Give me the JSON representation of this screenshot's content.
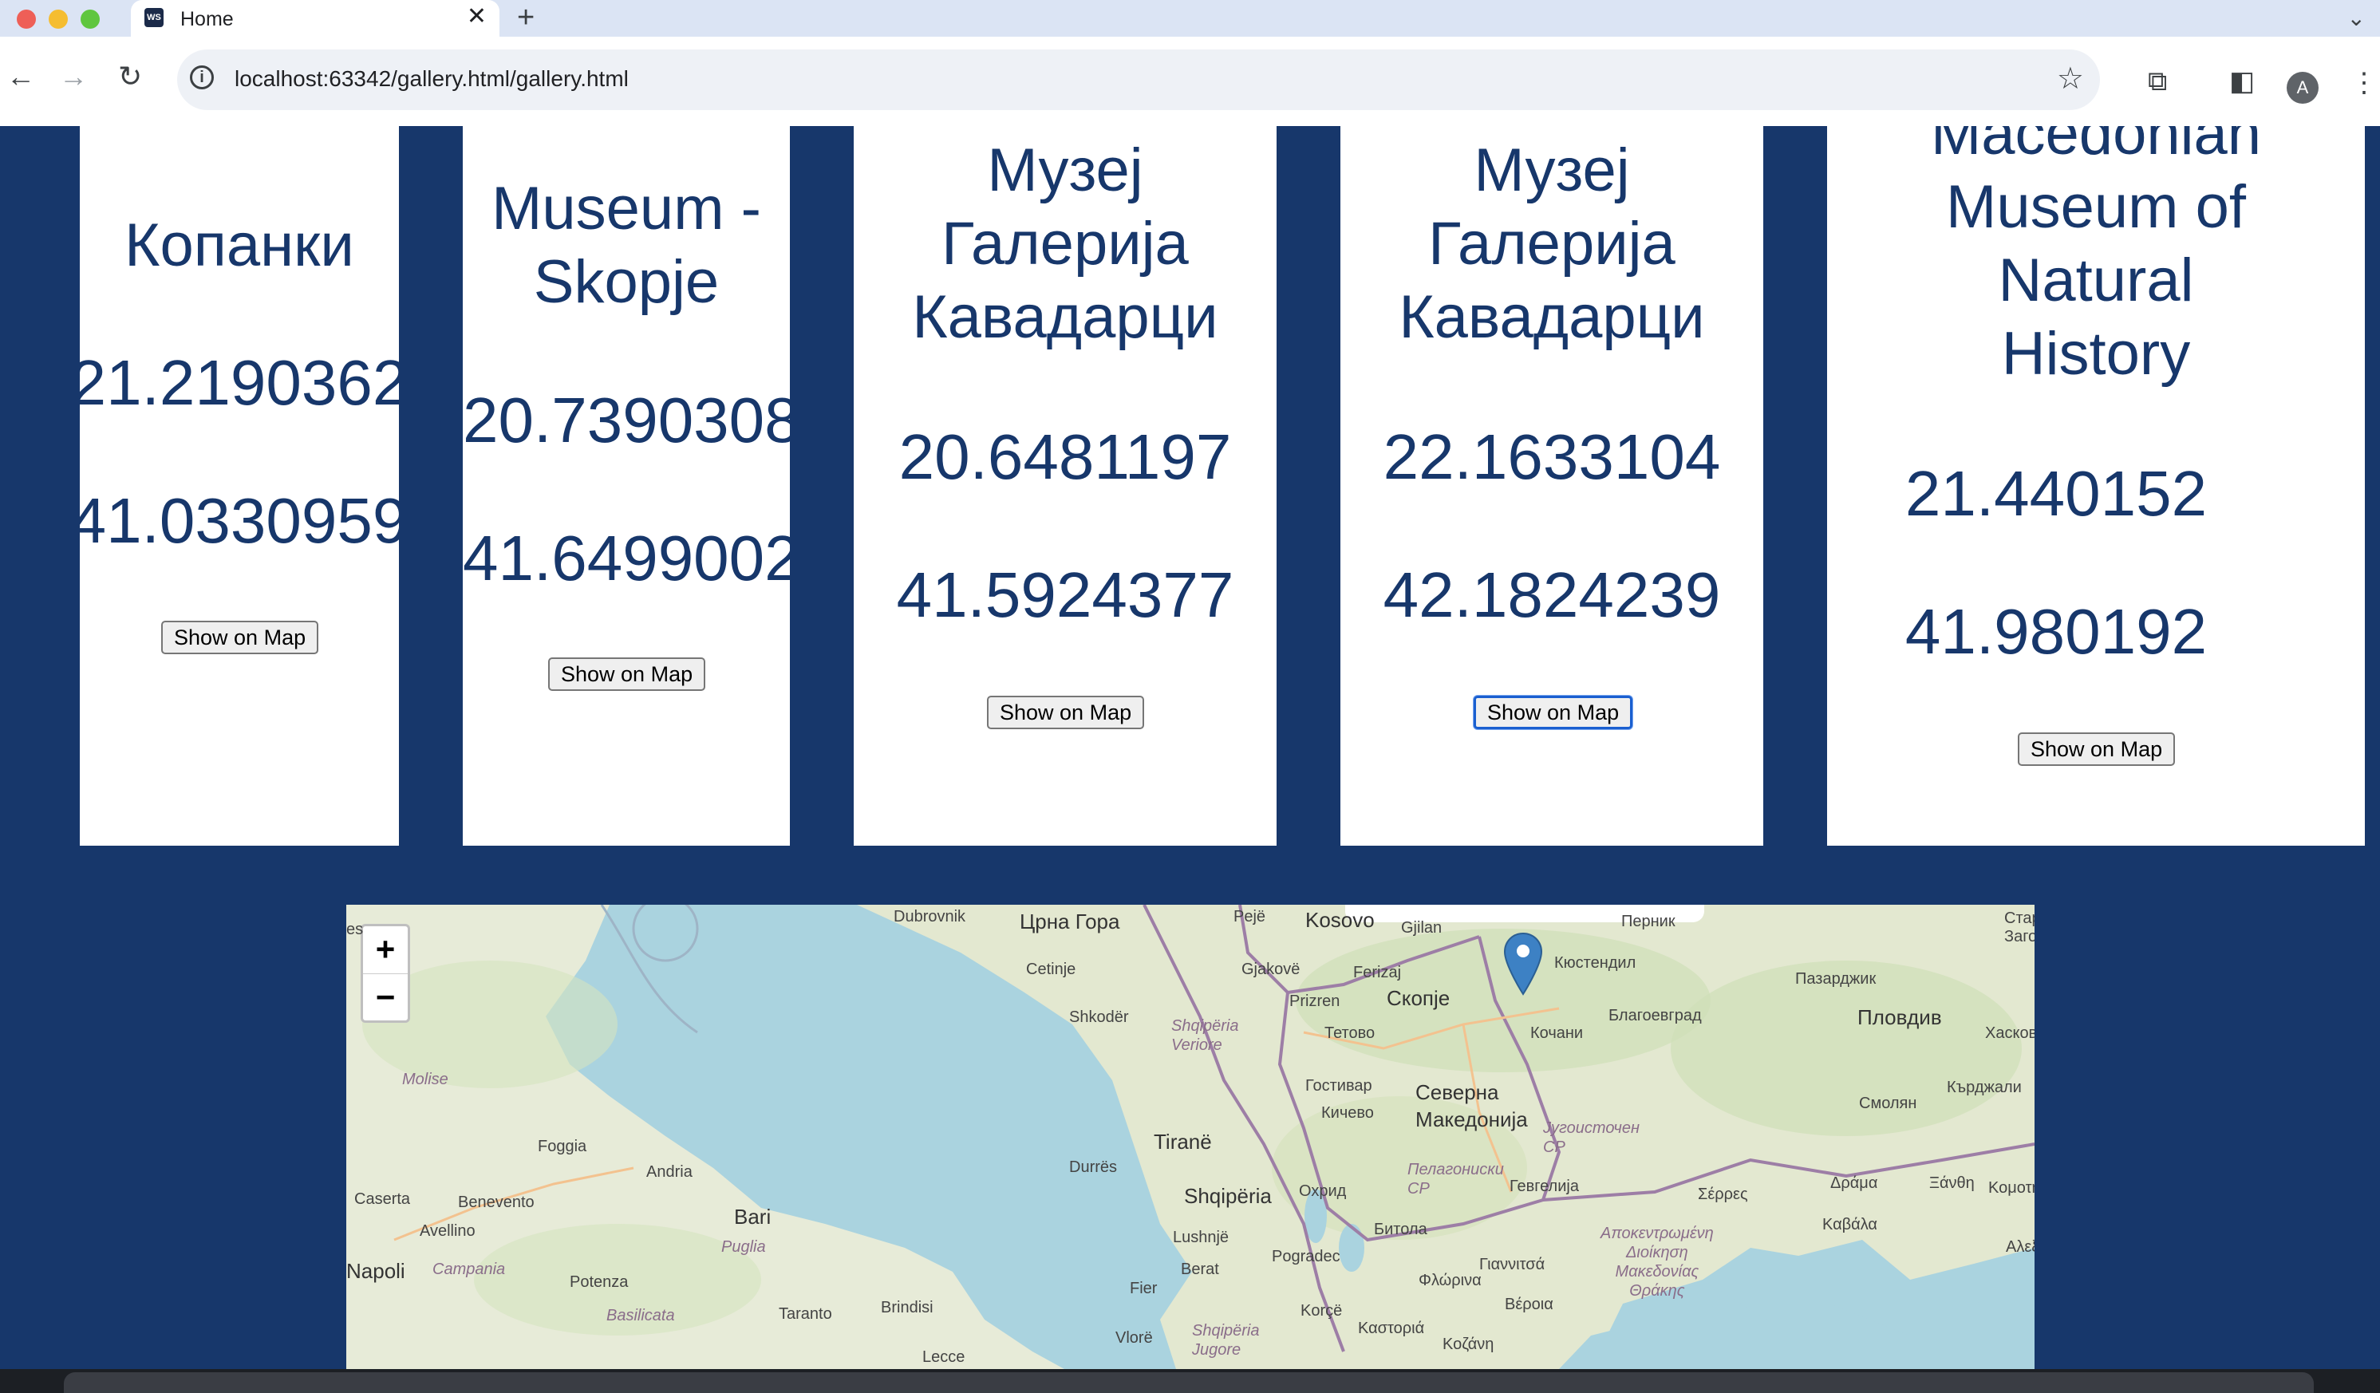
{
  "browser": {
    "tab_title": "Home",
    "tab_favicon_text": "WS",
    "url": "localhost:63342/gallery.html/gallery.html",
    "profile_initial": "A"
  },
  "cards": [
    {
      "name": "Копанки",
      "lon": "21.2190362",
      "lat": "41.0330959",
      "button": "Show on Map"
    },
    {
      "name": "Museum -\nSkopje",
      "lon": "20.7390308",
      "lat": "41.6499002",
      "button": "Show on Map"
    },
    {
      "name": "Музеј\nГалерија\nКавадарци",
      "lon": "20.6481197",
      "lat": "41.5924377",
      "button": "Show on Map"
    },
    {
      "name": "Музеј\nГалерија\nКавадарци",
      "lon": "22.1633104",
      "lat": "42.1824239",
      "button": "Show on Map"
    },
    {
      "name": "Macedonian\nMuseum of\nNatural\nHistory",
      "lon": "21.440152",
      "lat": "41.980192",
      "button": "Show on Map"
    }
  ],
  "map": {
    "zoom_in": "+",
    "zoom_out": "−",
    "labels": {
      "dubrovnik": "Dubrovnik",
      "crna_gora": "Црна Гора",
      "peje": "Pejë",
      "kosovo": "Kosovo",
      "gjilan": "Gjilan",
      "pernik": "Перник",
      "cetinje": "Cetinje",
      "gjakove": "Gjakovë",
      "ferizaj": "Ferizaj",
      "kyustendil": "Кюстендил",
      "pazardzhik": "Пазарджик",
      "prizren": "Prizren",
      "skopje": "Скопје",
      "blagoevgrad": "Благоевград",
      "plovdiv": "Пловдив",
      "shkoder": "Shkodër",
      "shqiperia_veriore": "Shqipëria\nVeriore",
      "tetovo": "Тетово",
      "kochani": "Кочани",
      "haskovo": "Хасков",
      "molise": "Molise",
      "gostivar": "Гостивар",
      "severna_makedonija": "Северна\nМакедонија",
      "smolyan": "Смолян",
      "kardzhali": "Кърджали",
      "kichevo": "Кичево",
      "jugoistochen": "Југоисточен\nСР",
      "tirane": "Tiranë",
      "foggia": "Foggia",
      "durres": "Durrës",
      "andria": "Andria",
      "pelagoniski": "Пелагониски\nСР",
      "ohrid": "Охрид",
      "gevgelija": "Гевгелија",
      "serres": "Σέρρες",
      "drama": "Δράμα",
      "xanthi": "Ξάνθη",
      "komotini": "Κομοτηνή",
      "shqiperia": "Shqipëria",
      "caserta": "Caserta",
      "benevento": "Benevento",
      "bari": "Bari",
      "avellino": "Avellino",
      "bitola": "Битола",
      "kavala": "Καβάλα",
      "puglia": "Puglia",
      "napoli": "Napoli",
      "campania": "Campania",
      "lushnje": "Lushnjë",
      "pogradec": "Pogradec",
      "giannitsa": "Γιαννιτσά",
      "apokentromeni": "Αποκεντρωμένη\nΔιοίκηση\nΜακεδονίας\nΘράκης",
      "berat": "Berat",
      "potenza": "Potenza",
      "florina": "Φλώρινα",
      "brindisi": "Brindisi",
      "fier": "Fier",
      "basilicata": "Basilicata",
      "veroia": "Βέροια",
      "taranto": "Taranto",
      "korce": "Korçë",
      "lecce": "Lecce",
      "vlore": "Vlorë",
      "kastoria": "Καστοριά",
      "kozani": "Κοζάνη",
      "shqiperia_jugore": "Shqipëria\nJugore",
      "alexandroupoli": "Αλεξ",
      "stara_zagora": "Стар\nЗаго",
      "es": "es"
    }
  }
}
